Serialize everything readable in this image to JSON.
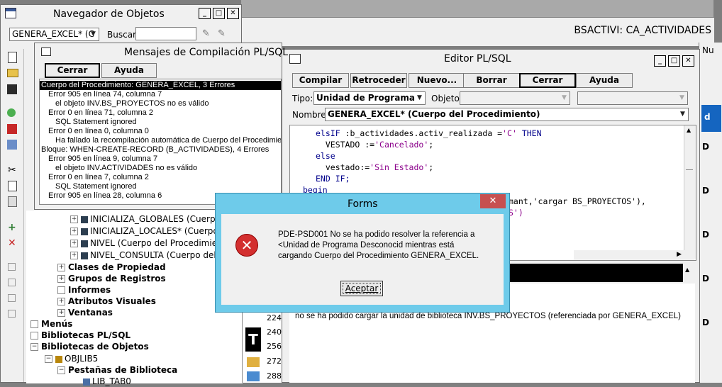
{
  "app_title": "BSACTIVI: CA_ACTIVIDADES",
  "navigator": {
    "title": "Navegador de Objetos",
    "module_select": "GENERA_EXCEL* (C",
    "search_label": "Buscar:",
    "items": [
      {
        "label": "INICIALIZA_GLOBALES (Cuerpo d",
        "bold": false
      },
      {
        "label": "INICIALIZA_LOCALES* (Cuerpo d",
        "bold": false
      },
      {
        "label": "NIVEL (Cuerpo del Procedimient",
        "bold": false
      },
      {
        "label": "NIVEL_CONSULTA (Cuerpo del P",
        "bold": false
      },
      {
        "label": "Clases de Propiedad",
        "bold": true
      },
      {
        "label": "Grupos de Registros",
        "bold": true
      },
      {
        "label": "Informes",
        "bold": true
      },
      {
        "label": "Atributos Visuales",
        "bold": true
      },
      {
        "label": "Ventanas",
        "bold": true
      },
      {
        "label": "Menús",
        "bold": true
      },
      {
        "label": "Bibliotecas PL/SQL",
        "bold": true
      },
      {
        "label": "Bibliotecas de Objetos",
        "bold": true
      },
      {
        "label": "OBJLIB5",
        "bold": false
      },
      {
        "label": "Pestañas de Biblioteca",
        "bold": true
      },
      {
        "label": "LIB_TAB0",
        "bold": false
      }
    ],
    "line_numbers": [
      "224",
      "240",
      "256",
      "272",
      "288"
    ]
  },
  "compilation": {
    "title": "Mensajes de Compilación PL/SQL",
    "close_label": "Cerrar",
    "help_label": "Ayuda",
    "messages": [
      "Cuerpo del Procedimiento: GENERA_EXCEL, 3 Errores",
      "Error 905 en línea 74, columna 7",
      "el objeto INV.BS_PROYECTOS no es válido",
      "Error 0 en línea 71, columna 2",
      "SQL Statement ignored",
      "Error 0 en línea 0, columna 0",
      "Ha fallado la recompilación automática de Cuerpo del Procedimiento",
      "Bloque: WHEN-CREATE-RECORD (B_ACTIVIDADES), 4 Errores",
      "Error 905 en línea 9, columna 7",
      "el objeto INV.ACTIVIDADES no es válido",
      "Error 0 en línea 7, columna 2",
      "SQL Statement ignored",
      "Error 905 en línea 28, columna 6"
    ]
  },
  "editor": {
    "title": "Editor PL/SQL",
    "buttons": {
      "compile": "Compilar",
      "back": "Retroceder",
      "new": "Nuevo...",
      "delete": "Borrar",
      "close": "Cerrar",
      "help": "Ayuda"
    },
    "type_label": "Tipo:",
    "type_value": "Unidad de Programa",
    "object_label": "Objeto:",
    "name_label": "Nombre:",
    "name_value": "GENERA_EXCEL* (Cuerpo del Procedimiento)",
    "code": {
      "l1_kw": "elsIF",
      "l1_mid": " :b_actividades.activ_realizada =",
      "l1_str": "'C'",
      "l1_kw2": " THEN",
      "l2_a": "VESTADO :=",
      "l2_str": "'Cancelado'",
      "l2_b": ";",
      "l3": "else",
      "l4_a": "vestado:=",
      "l4_str": "'Sin Estado'",
      "l4_b": ";",
      "l5": "END IF;",
      "l6": "begin",
      "l7": "mant,'cargar BS_PROYECTOS'),",
      "l8": "S')"
    },
    "status_message": "no se ha podido cargar la unidad de biblioteca INV.BS_PROYECTOS (referenciada por GENERA_EXCEL)"
  },
  "right_panel": {
    "nu_label": "Nu",
    "d_labels": [
      "d",
      "D",
      "D",
      "D",
      "D",
      "D"
    ]
  },
  "dialog": {
    "title": "Forms",
    "message_line1": "PDE-PSD001 No se ha podido resolver la referencia a",
    "message_line2": "<Unidad de Programa Desconocid mientras está",
    "message_line3": "cargando Cuerpo del Procedimiento GENERA_EXCEL.",
    "ok_label": "Aceptar",
    "close_symbol": "✕"
  },
  "colors": {
    "dialog_title": "#6ecbea",
    "dialog_close": "#c75050",
    "selection": "#000000",
    "blue_accent": "#1565c0"
  }
}
